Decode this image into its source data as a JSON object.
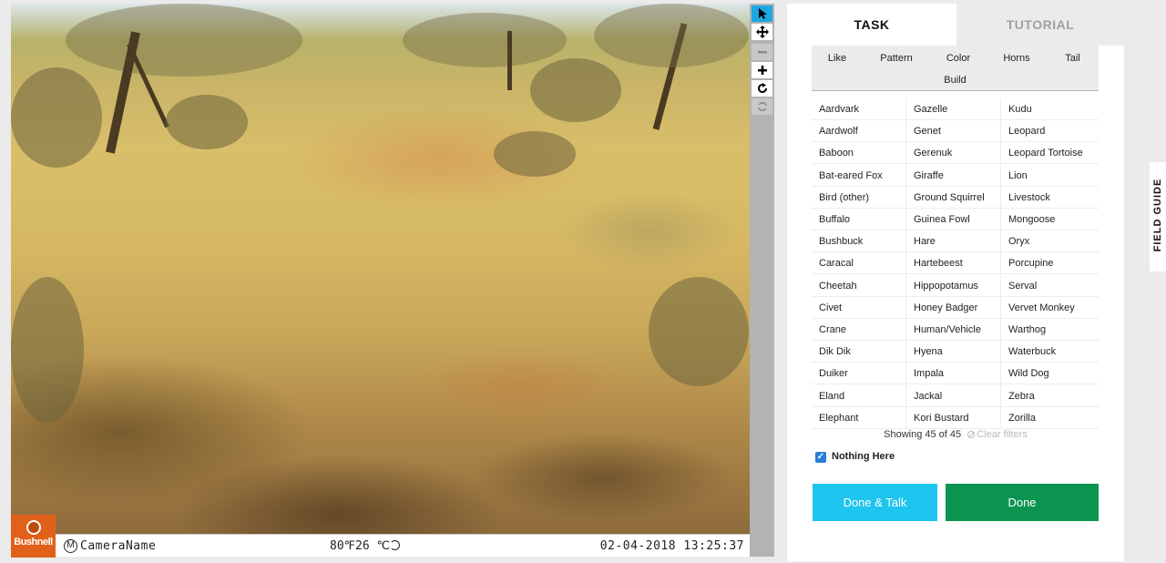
{
  "camera_overlay": {
    "brand": "Bushnell",
    "camera_name": "CameraName",
    "temperature": "80℉26 ℃",
    "datetime": "02-04-2018 13:25:37"
  },
  "toolbar": {
    "tools": [
      "pointer-icon",
      "move-icon",
      "zoom-out-icon",
      "zoom-in-icon",
      "rotate-icon",
      "reset-icon"
    ],
    "active_color": "#1ea7e1"
  },
  "tabs": {
    "task": "TASK",
    "tutorial": "TUTORIAL"
  },
  "filters": [
    "Like",
    "Pattern",
    "Color",
    "Horns",
    "Tail",
    "Build"
  ],
  "species": [
    [
      "Aardvark",
      "Gazelle",
      "Kudu"
    ],
    [
      "Aardwolf",
      "Genet",
      "Leopard"
    ],
    [
      "Baboon",
      "Gerenuk",
      "Leopard Tortoise"
    ],
    [
      "Bat-eared Fox",
      "Giraffe",
      "Lion"
    ],
    [
      "Bird (other)",
      "Ground Squirrel",
      "Livestock"
    ],
    [
      "Buffalo",
      "Guinea Fowl",
      "Mongoose"
    ],
    [
      "Bushbuck",
      "Hare",
      "Oryx"
    ],
    [
      "Caracal",
      "Hartebeest",
      "Porcupine"
    ],
    [
      "Cheetah",
      "Hippopotamus",
      "Serval"
    ],
    [
      "Civet",
      "Honey Badger",
      "Vervet Monkey"
    ],
    [
      "Crane",
      "Human/Vehicle",
      "Warthog"
    ],
    [
      "Dik Dik",
      "Hyena",
      "Waterbuck"
    ],
    [
      "Duiker",
      "Impala",
      "Wild Dog"
    ],
    [
      "Eland",
      "Jackal",
      "Zebra"
    ],
    [
      "Elephant",
      "Kori Bustard",
      "Zorilla"
    ]
  ],
  "status": {
    "showing": "Showing 45 of 45",
    "clear_filters": "Clear filters"
  },
  "nothing_here": {
    "label": "Nothing Here",
    "checked": true
  },
  "buttons": {
    "done_talk": "Done & Talk",
    "done": "Done"
  },
  "field_guide": "FIELD GUIDE",
  "colors": {
    "done_talk": "#1ec5ee",
    "done": "#0b9450",
    "checkbox": "#2b7bd8"
  }
}
